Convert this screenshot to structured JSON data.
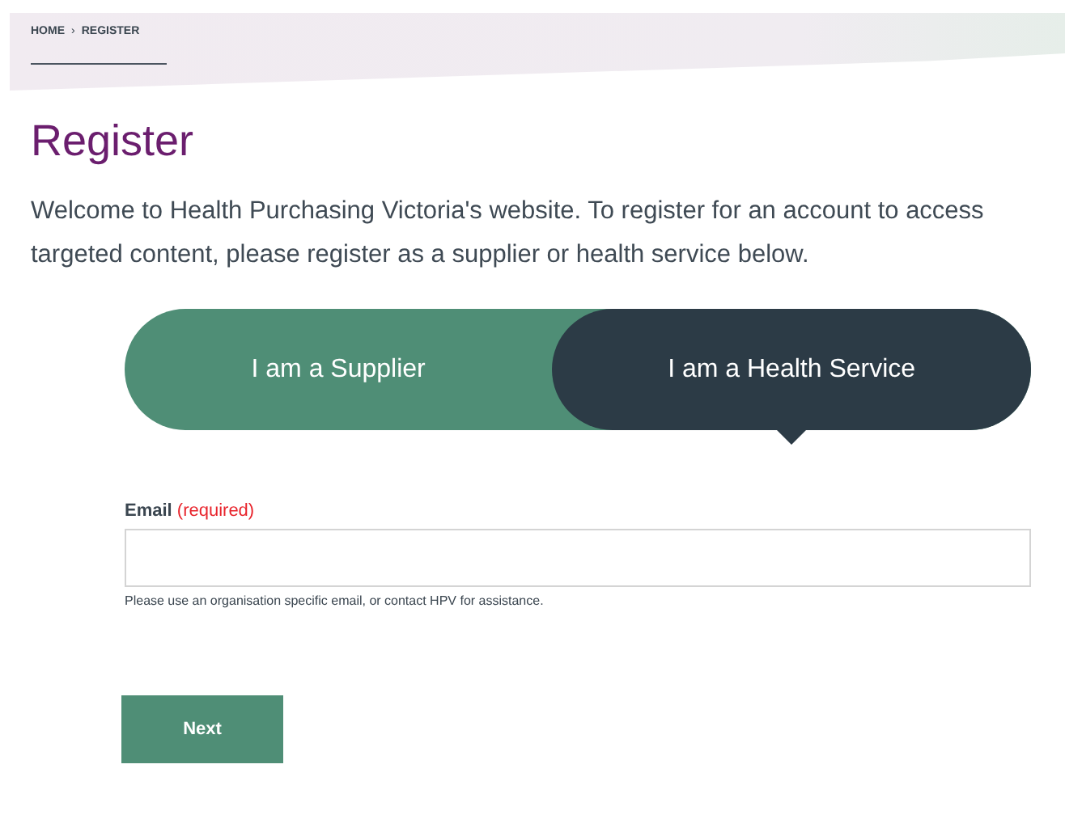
{
  "breadcrumb": {
    "items": [
      "HOME",
      "REGISTER"
    ],
    "separator": "›"
  },
  "title": "Register",
  "intro": "Welcome to Health Purchasing Victoria's website. To register for an account to access targeted content, please register as a supplier or health service below.",
  "account_type": [
    {
      "label": "I am a Supplier",
      "selected": false
    },
    {
      "label": "I am a Health Service",
      "selected": true
    }
  ],
  "email": {
    "label": "Email",
    "required": "(required)",
    "help": "Please use an organisation specific email, or contact HPV for assistance."
  },
  "buttons": [
    "Next"
  ]
}
